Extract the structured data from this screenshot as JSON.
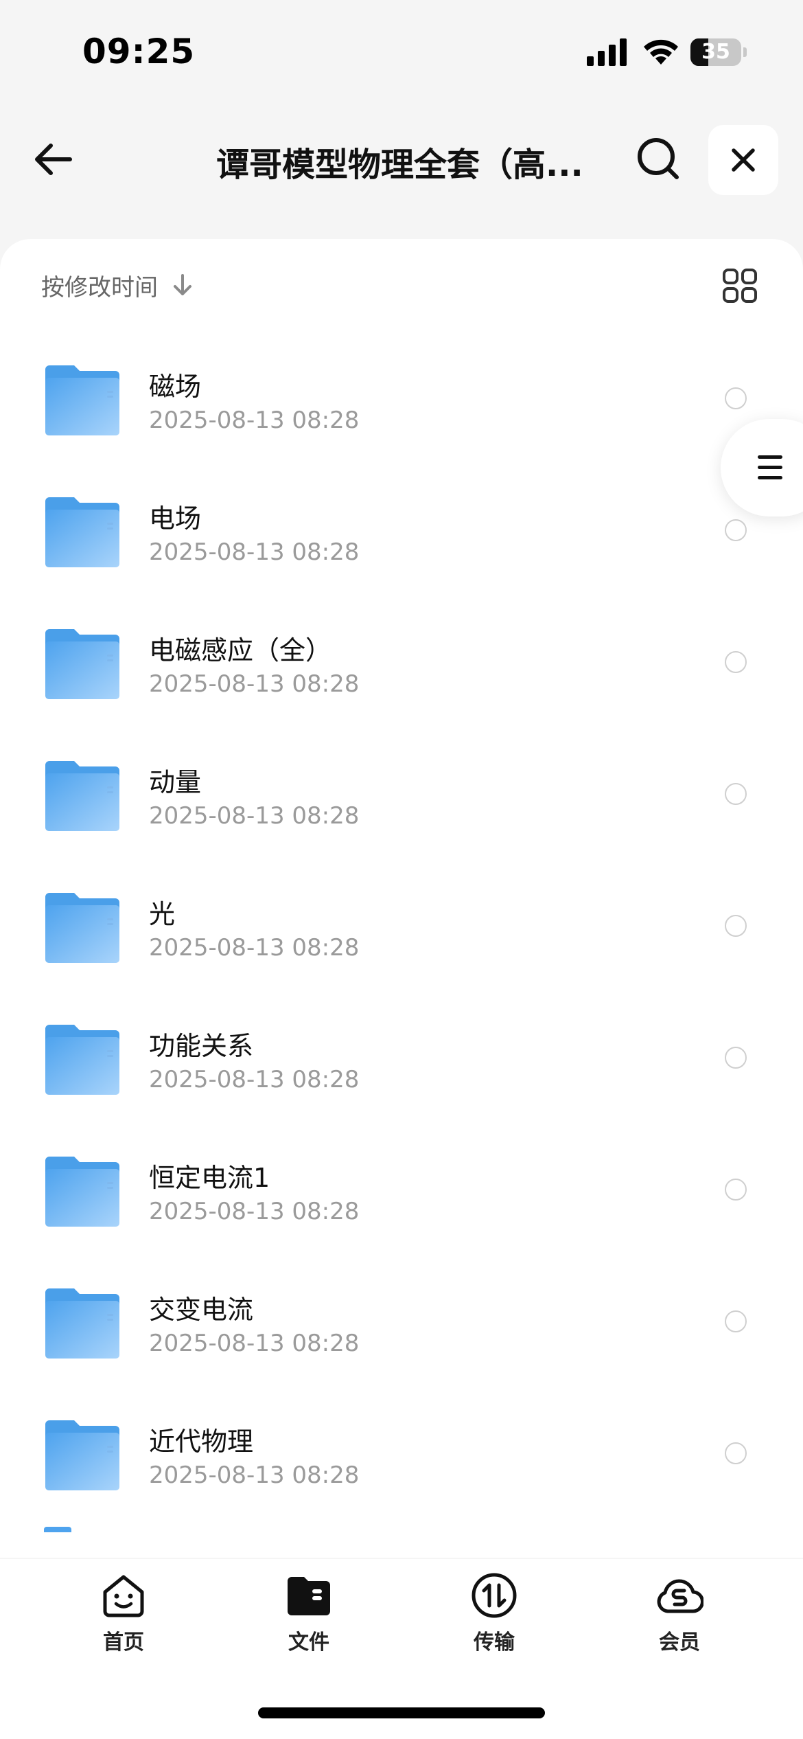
{
  "status_bar": {
    "time": "09:25",
    "battery": "35",
    "battery_level": 0.35
  },
  "nav": {
    "title": "谭哥模型物理全套（高..."
  },
  "toolbar": {
    "sort_label": "按修改时间"
  },
  "files": [
    {
      "name": "磁场",
      "date": "2025-08-13 08:28"
    },
    {
      "name": "电场",
      "date": "2025-08-13 08:28"
    },
    {
      "name": "电磁感应（全）",
      "date": "2025-08-13 08:28"
    },
    {
      "name": "动量",
      "date": "2025-08-13 08:28"
    },
    {
      "name": "光",
      "date": "2025-08-13 08:28"
    },
    {
      "name": "功能关系",
      "date": "2025-08-13 08:28"
    },
    {
      "name": "恒定电流1",
      "date": "2025-08-13 08:28"
    },
    {
      "name": "交变电流",
      "date": "2025-08-13 08:28"
    },
    {
      "name": "近代物理",
      "date": "2025-08-13 08:28"
    }
  ],
  "tabs": [
    {
      "label": "首页",
      "icon": "home-smile-icon"
    },
    {
      "label": "文件",
      "icon": "folder-icon"
    },
    {
      "label": "传输",
      "icon": "transfer-icon"
    },
    {
      "label": "会员",
      "icon": "vip-cloud-icon"
    }
  ],
  "colors": {
    "folder": "#5aacf0",
    "accent": "#111111"
  }
}
